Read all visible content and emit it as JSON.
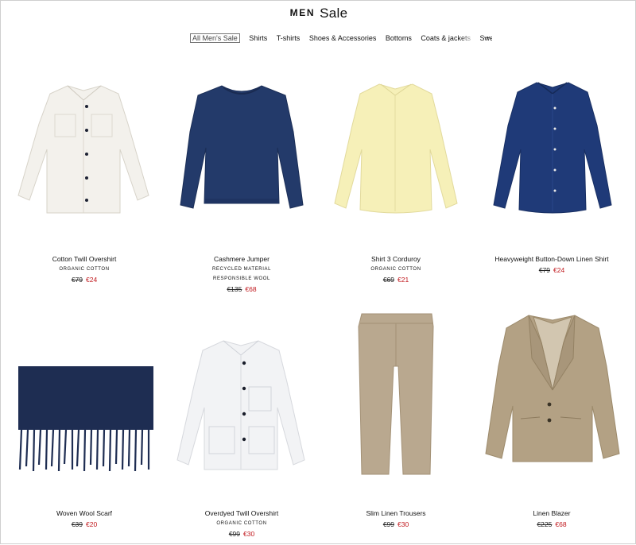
{
  "header": {
    "section": "MEN",
    "title": "Sale"
  },
  "nav": {
    "items": [
      "All Men's Sale",
      "Shirts",
      "T-shirts",
      "Shoes & Accessories",
      "Bottoms",
      "Coats & jackets",
      "Sweatshirts"
    ],
    "arrow": "→"
  },
  "products": [
    {
      "name": "Cotton Twill Overshirt",
      "tags": [
        "ORGANIC COTTON"
      ],
      "old_price": "€79",
      "new_price": "€24"
    },
    {
      "name": "Cashmere Jumper",
      "tags": [
        "RECYCLED MATERIAL",
        "RESPONSIBLE WOOL"
      ],
      "old_price": "€135",
      "new_price": "€68"
    },
    {
      "name": "Shirt 3 Corduroy",
      "tags": [
        "ORGANIC COTTON"
      ],
      "old_price": "€69",
      "new_price": "€21"
    },
    {
      "name": "Heavyweight Button-Down Linen Shirt",
      "tags": [],
      "old_price": "€79",
      "new_price": "€24"
    },
    {
      "name": "Woven Wool Scarf",
      "tags": [],
      "old_price": "€39",
      "new_price": "€20"
    },
    {
      "name": "Overdyed Twill Overshirt",
      "tags": [
        "ORGANIC COTTON"
      ],
      "old_price": "€99",
      "new_price": "€30"
    },
    {
      "name": "Slim Linen Trousers",
      "tags": [],
      "old_price": "€99",
      "new_price": "€30"
    },
    {
      "name": "Linen Blazer",
      "tags": [],
      "old_price": "€225",
      "new_price": "€68"
    }
  ],
  "colors": {
    "sale_price": "#c0171c"
  }
}
